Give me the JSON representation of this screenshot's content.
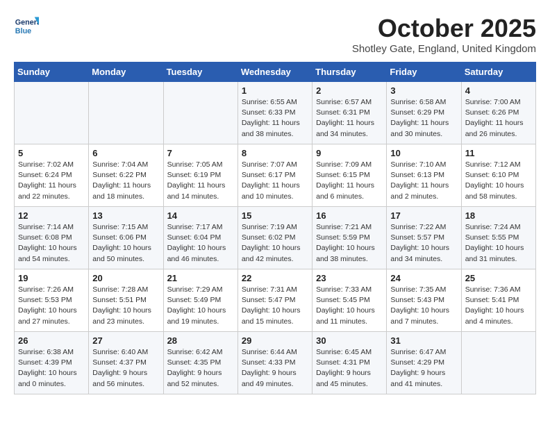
{
  "logo": {
    "line1": "General",
    "line2": "Blue"
  },
  "title": "October 2025",
  "subtitle": "Shotley Gate, England, United Kingdom",
  "days_of_week": [
    "Sunday",
    "Monday",
    "Tuesday",
    "Wednesday",
    "Thursday",
    "Friday",
    "Saturday"
  ],
  "weeks": [
    [
      {
        "num": "",
        "info": ""
      },
      {
        "num": "",
        "info": ""
      },
      {
        "num": "",
        "info": ""
      },
      {
        "num": "1",
        "info": "Sunrise: 6:55 AM\nSunset: 6:33 PM\nDaylight: 11 hours and 38 minutes."
      },
      {
        "num": "2",
        "info": "Sunrise: 6:57 AM\nSunset: 6:31 PM\nDaylight: 11 hours and 34 minutes."
      },
      {
        "num": "3",
        "info": "Sunrise: 6:58 AM\nSunset: 6:29 PM\nDaylight: 11 hours and 30 minutes."
      },
      {
        "num": "4",
        "info": "Sunrise: 7:00 AM\nSunset: 6:26 PM\nDaylight: 11 hours and 26 minutes."
      }
    ],
    [
      {
        "num": "5",
        "info": "Sunrise: 7:02 AM\nSunset: 6:24 PM\nDaylight: 11 hours and 22 minutes."
      },
      {
        "num": "6",
        "info": "Sunrise: 7:04 AM\nSunset: 6:22 PM\nDaylight: 11 hours and 18 minutes."
      },
      {
        "num": "7",
        "info": "Sunrise: 7:05 AM\nSunset: 6:19 PM\nDaylight: 11 hours and 14 minutes."
      },
      {
        "num": "8",
        "info": "Sunrise: 7:07 AM\nSunset: 6:17 PM\nDaylight: 11 hours and 10 minutes."
      },
      {
        "num": "9",
        "info": "Sunrise: 7:09 AM\nSunset: 6:15 PM\nDaylight: 11 hours and 6 minutes."
      },
      {
        "num": "10",
        "info": "Sunrise: 7:10 AM\nSunset: 6:13 PM\nDaylight: 11 hours and 2 minutes."
      },
      {
        "num": "11",
        "info": "Sunrise: 7:12 AM\nSunset: 6:10 PM\nDaylight: 10 hours and 58 minutes."
      }
    ],
    [
      {
        "num": "12",
        "info": "Sunrise: 7:14 AM\nSunset: 6:08 PM\nDaylight: 10 hours and 54 minutes."
      },
      {
        "num": "13",
        "info": "Sunrise: 7:15 AM\nSunset: 6:06 PM\nDaylight: 10 hours and 50 minutes."
      },
      {
        "num": "14",
        "info": "Sunrise: 7:17 AM\nSunset: 6:04 PM\nDaylight: 10 hours and 46 minutes."
      },
      {
        "num": "15",
        "info": "Sunrise: 7:19 AM\nSunset: 6:02 PM\nDaylight: 10 hours and 42 minutes."
      },
      {
        "num": "16",
        "info": "Sunrise: 7:21 AM\nSunset: 5:59 PM\nDaylight: 10 hours and 38 minutes."
      },
      {
        "num": "17",
        "info": "Sunrise: 7:22 AM\nSunset: 5:57 PM\nDaylight: 10 hours and 34 minutes."
      },
      {
        "num": "18",
        "info": "Sunrise: 7:24 AM\nSunset: 5:55 PM\nDaylight: 10 hours and 31 minutes."
      }
    ],
    [
      {
        "num": "19",
        "info": "Sunrise: 7:26 AM\nSunset: 5:53 PM\nDaylight: 10 hours and 27 minutes."
      },
      {
        "num": "20",
        "info": "Sunrise: 7:28 AM\nSunset: 5:51 PM\nDaylight: 10 hours and 23 minutes."
      },
      {
        "num": "21",
        "info": "Sunrise: 7:29 AM\nSunset: 5:49 PM\nDaylight: 10 hours and 19 minutes."
      },
      {
        "num": "22",
        "info": "Sunrise: 7:31 AM\nSunset: 5:47 PM\nDaylight: 10 hours and 15 minutes."
      },
      {
        "num": "23",
        "info": "Sunrise: 7:33 AM\nSunset: 5:45 PM\nDaylight: 10 hours and 11 minutes."
      },
      {
        "num": "24",
        "info": "Sunrise: 7:35 AM\nSunset: 5:43 PM\nDaylight: 10 hours and 7 minutes."
      },
      {
        "num": "25",
        "info": "Sunrise: 7:36 AM\nSunset: 5:41 PM\nDaylight: 10 hours and 4 minutes."
      }
    ],
    [
      {
        "num": "26",
        "info": "Sunrise: 6:38 AM\nSunset: 4:39 PM\nDaylight: 10 hours and 0 minutes."
      },
      {
        "num": "27",
        "info": "Sunrise: 6:40 AM\nSunset: 4:37 PM\nDaylight: 9 hours and 56 minutes."
      },
      {
        "num": "28",
        "info": "Sunrise: 6:42 AM\nSunset: 4:35 PM\nDaylight: 9 hours and 52 minutes."
      },
      {
        "num": "29",
        "info": "Sunrise: 6:44 AM\nSunset: 4:33 PM\nDaylight: 9 hours and 49 minutes."
      },
      {
        "num": "30",
        "info": "Sunrise: 6:45 AM\nSunset: 4:31 PM\nDaylight: 9 hours and 45 minutes."
      },
      {
        "num": "31",
        "info": "Sunrise: 6:47 AM\nSunset: 4:29 PM\nDaylight: 9 hours and 41 minutes."
      },
      {
        "num": "",
        "info": ""
      }
    ]
  ]
}
